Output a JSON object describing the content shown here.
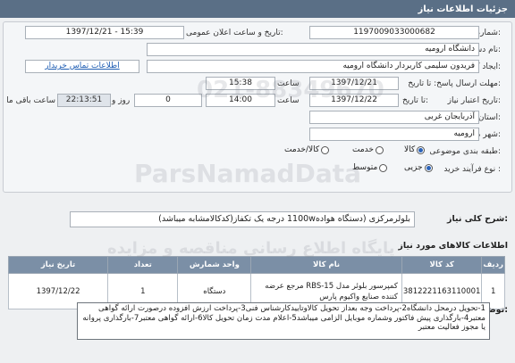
{
  "header": {
    "title": "جزئیات اطلاعات نیاز"
  },
  "form": {
    "need_number_label": "شماره نیاز:",
    "need_number": "1197009033000682",
    "announce_label": "تاریخ و ساعت اعلان عمومی:",
    "announce_value": "1397/12/21 - 15:39",
    "buyer_org_label": "نام دستگاه خریدار:",
    "buyer_org": "دانشگاه ارومیه",
    "creator_label": "ایجاد کننده درخواست:",
    "creator": "فریدون سلیمی کاربردار دانشگاه ارومیه",
    "contact_link": "اطلاعات تماس خریدار",
    "deadline_label": "مهلت ارسال پاسخ: تا تاریخ:",
    "deadline_date": "1397/12/21",
    "deadline_time_label": "ساعت",
    "deadline_time": "15:38",
    "validity_label": "تاریخ اعتبار نیاز:",
    "validity_to_label": "تا تاریخ:",
    "validity_date": "1397/12/22",
    "validity_time_label": "ساعت",
    "validity_time": "14:00",
    "days_value": "0",
    "days_label": "روز و",
    "remaining_time": "22:13:51",
    "remaining_label": "ساعت باقی مانده",
    "province_label": "استان محل تحویل:",
    "province": "آذربایجان غربی",
    "city_label": "شهر محل تحویل:",
    "city": "ارومیه",
    "category_label": "طبقه بندی موضوعی:",
    "category_options": [
      "کالا",
      "خدمت",
      "کالا/خدمت"
    ],
    "category_selected": "کالا",
    "process_label": "نوع فرآیند خرید :",
    "process_options": [
      "جزیی",
      "متوسط"
    ],
    "process_selected": "جزیی"
  },
  "summary": {
    "label": "شرح کلی نیاز:",
    "text": "بلولرمرکزی (دستگاه هواده1100w درجه یک تکفاز(کدکالامشابه میباشد)"
  },
  "goods": {
    "section_label": "اطلاعات کالاهای مورد نیاز",
    "columns": [
      "ردیف",
      "کد کالا",
      "نام کالا",
      "واحد شمارش",
      "تعداد",
      "تاریخ نیاز"
    ],
    "rows": [
      {
        "index": "1",
        "code": "3812221163110001",
        "name": "کمپرسور بلوئر مدل RBS-15 مرجع عرضه کننده صنایع واکیوم پارس",
        "unit": "دستگاه",
        "qty": "1",
        "date": "1397/12/22"
      }
    ]
  },
  "buyer_notes": {
    "label": "توضیحات خریدار:",
    "text": "1-تحویل درمحل دانشگاه2-پرداخت وجه بعداز تحویل کالاوتاییدکارشناس فنی3-پرداخت ارزش افزوده درصورت ارائه گواهی معتبر4-بارگذاری پیش فاکتور وشماره موبایل الزامی میباشد5-اعلام مدت زمان تحویل کالا6-ارائه گواهی معتبر7-بارگذاری پروانه یا مجوز فعالیت معتبر"
  },
  "watermark": {
    "brand": "ParsNamadData",
    "line1": "پایگاه اطلاع رسانی مناقصه و مزایده",
    "line2": "021-88349670"
  }
}
